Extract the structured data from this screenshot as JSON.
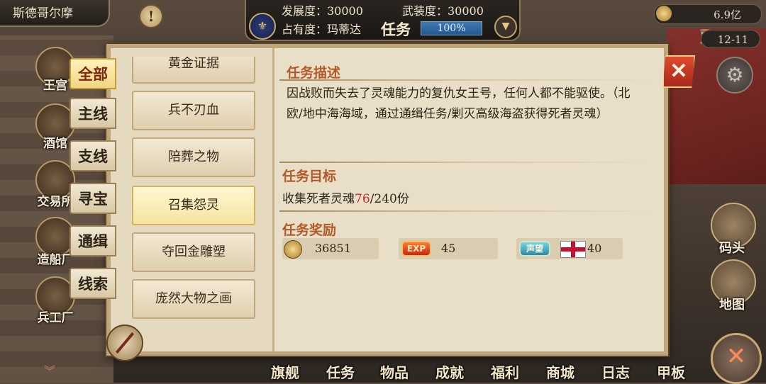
{
  "topbar": {
    "city_name": "斯德哥尔摩",
    "development": "发展度：30000",
    "armament": "武装度：30000",
    "occupancy": "占有度：玛蒂达",
    "task_label": "任务",
    "progress_text": "100%",
    "progress_value": 1.0,
    "gold": "6.9亿",
    "date": "12-11"
  },
  "left_nav": [
    "王宫",
    "酒馆",
    "交易所",
    "造船厂",
    "兵工厂"
  ],
  "categories": [
    "全部",
    "主线",
    "支线",
    "寻宝",
    "通缉",
    "线索"
  ],
  "active_category": 0,
  "quests": [
    "黄金证据",
    "兵不刃血",
    "陪葬之物",
    "召集怨灵",
    "夺回金雕塑",
    "庞然大物之画"
  ],
  "active_quest": 3,
  "detail": {
    "desc_title": "任务描述",
    "description": "因战败而失去了灵魂能力的复仇女王号，任何人都不能驱使。（北欧/地中海海域，通过通缉任务/剿灭高级海盗获得死者灵魂）",
    "goal_title": "任务目标",
    "goal_prefix": "收集死者灵魂",
    "goal_current": "76",
    "goal_suffix": "/240份",
    "reward_title": "任务奖励",
    "reward_gold": "36851",
    "reward_exp_label": "EXP",
    "reward_exp": "45",
    "reward_rep_label": "声望",
    "reward_rep": "40"
  },
  "close_label": "✕",
  "right_nav": [
    "码头",
    "地图"
  ],
  "bottom_nav": [
    "旗舰",
    "任务",
    "物品",
    "成就",
    "福利",
    "商城",
    "日志",
    "甲板"
  ]
}
